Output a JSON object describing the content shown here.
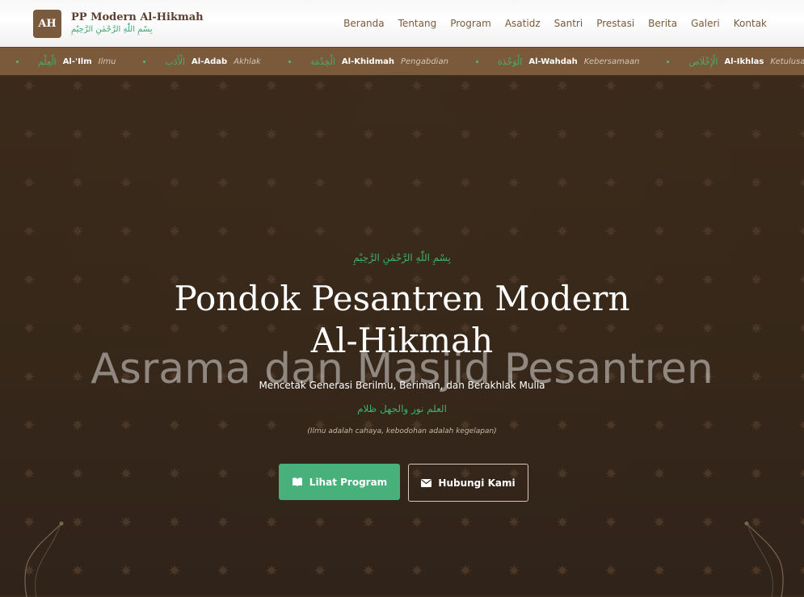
{
  "header": {
    "logo_text": "AH",
    "title": "PP Modern Al-Hikmah",
    "subtitle_arabic": "بِسْمِ اللّٰهِ الرَّحْمٰنِ الرَّحِيْمِ"
  },
  "nav": {
    "items": [
      "Beranda",
      "Tentang",
      "Program",
      "Asatidz",
      "Santri",
      "Prestasi",
      "Berita",
      "Galeri",
      "Kontak"
    ]
  },
  "ticker": {
    "items": [
      {
        "arabic": "الْعِلْم",
        "name": "Al-'Ilm",
        "translation": "Ilmu"
      },
      {
        "arabic": "الْأَدَب",
        "name": "Al-Adab",
        "translation": "Akhlak"
      },
      {
        "arabic": "الْخِدْمَة",
        "name": "Al-Khidmah",
        "translation": "Pengabdian"
      },
      {
        "arabic": "الْوَحْدَة",
        "name": "Al-Wahdah",
        "translation": "Kebersamaan"
      },
      {
        "arabic": "الْإِخْلَاص",
        "name": "Al-Ikhlas",
        "translation": "Ketulusan"
      }
    ]
  },
  "hero": {
    "bismillah": "بِسْمِ اللّٰهِ الرَّحْمٰنِ الرَّحِيْمِ",
    "title_line1": "Pondok Pesantren Modern",
    "title_line2": "Al-Hikmah",
    "watermark": "Asrama dan Masjid Pesantren",
    "tagline": "Mencetak Generasi Berilmu, Beriman, dan Berakhlak Mulia",
    "arabic_quote": "العلم نور والجهل ظلام",
    "translation": "(Ilmu adalah cahaya, kebodohan adalah kegelapan)",
    "primary_button": "Lihat Program",
    "secondary_button": "Hubungi Kami",
    "primary_icon": "book-icon",
    "secondary_icon": "envelope-icon"
  },
  "colors": {
    "brand_brown": "#7a5a3c",
    "accent_green": "#48b07a",
    "hero_background": "#372819"
  }
}
